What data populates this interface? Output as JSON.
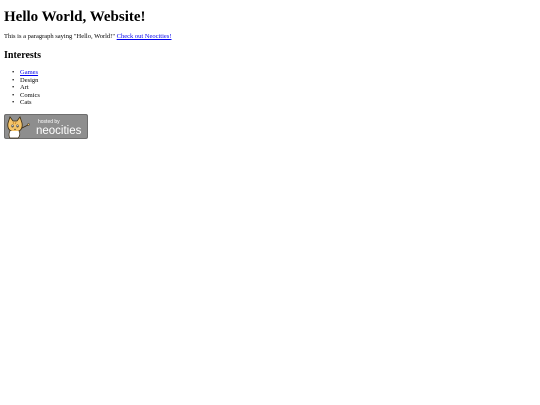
{
  "page": {
    "heading": "Hello World, Website!",
    "intro_text": "This is a paragraph saying \"Hello, World!\"",
    "intro_link": "Check out Neocities!"
  },
  "interests": {
    "heading": "Interests",
    "items": [
      {
        "label": "Games",
        "is_link": true
      },
      {
        "label": "Design",
        "is_link": false
      },
      {
        "label": "Art",
        "is_link": false
      },
      {
        "label": "Comics",
        "is_link": false
      },
      {
        "label": "Cats",
        "is_link": false
      }
    ]
  },
  "badge": {
    "small_text": "hosted by",
    "brand_text": "neocities",
    "icon": "neocities-cat-icon",
    "background_color": "#8e8e8e",
    "text_color": "#ffffff"
  },
  "colors": {
    "link": "#0000ee",
    "text": "#000000",
    "background": "#ffffff"
  }
}
